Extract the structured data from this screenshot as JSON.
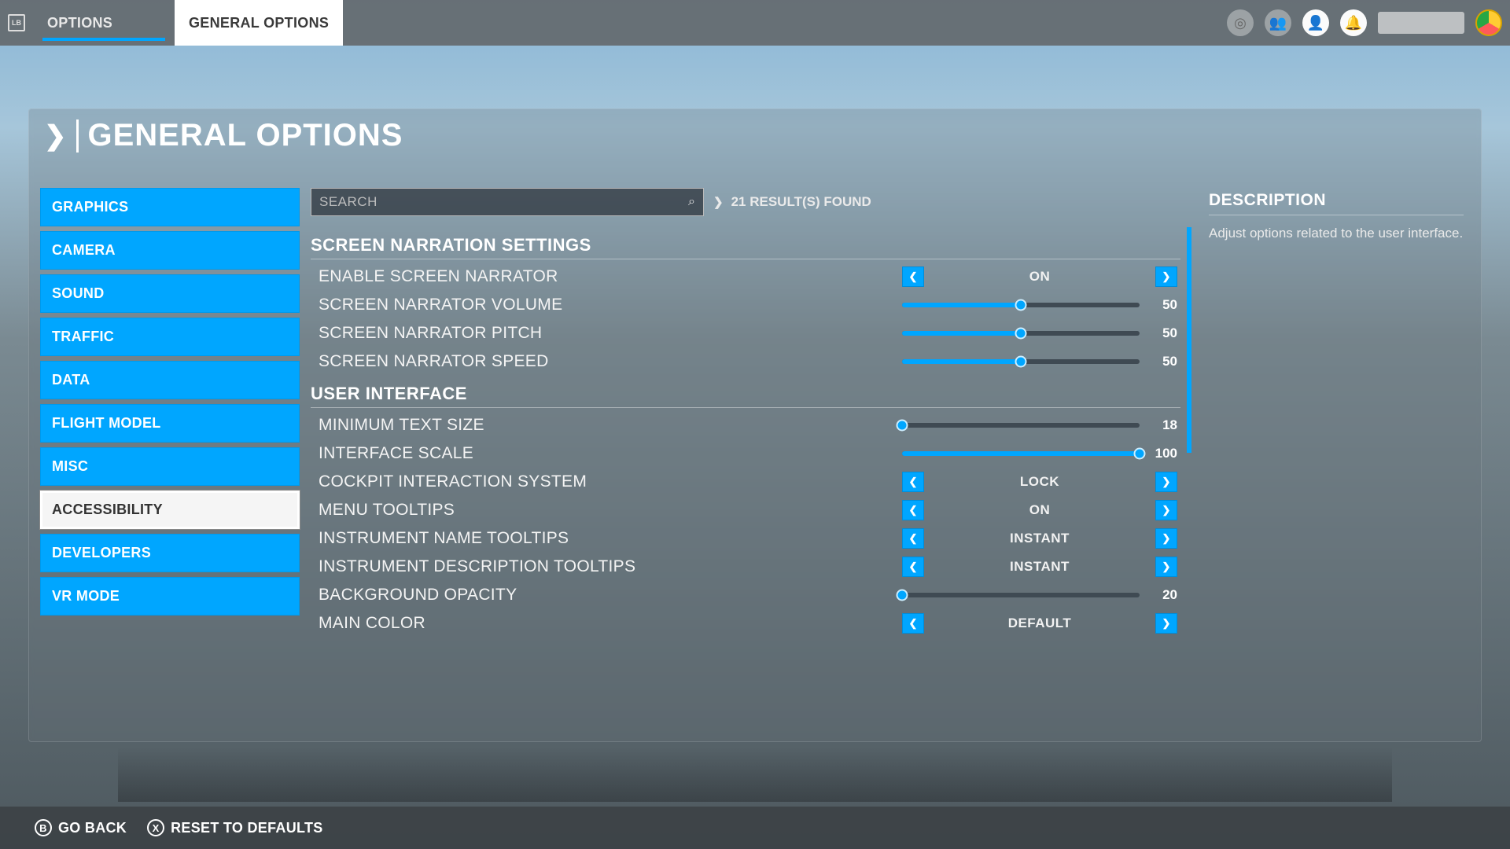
{
  "topbar": {
    "lb": "LB",
    "tabs": [
      {
        "label": "OPTIONS",
        "active": false,
        "accent": true
      },
      {
        "label": "GENERAL OPTIONS",
        "active": true,
        "accent": false
      }
    ]
  },
  "page": {
    "title": "GENERAL OPTIONS"
  },
  "sidebar": {
    "items": [
      {
        "label": "GRAPHICS",
        "selected": false
      },
      {
        "label": "CAMERA",
        "selected": false
      },
      {
        "label": "SOUND",
        "selected": false
      },
      {
        "label": "TRAFFIC",
        "selected": false
      },
      {
        "label": "DATA",
        "selected": false
      },
      {
        "label": "FLIGHT MODEL",
        "selected": false
      },
      {
        "label": "MISC",
        "selected": false
      },
      {
        "label": "ACCESSIBILITY",
        "selected": true
      },
      {
        "label": "DEVELOPERS",
        "selected": false
      },
      {
        "label": "VR MODE",
        "selected": false
      }
    ]
  },
  "search": {
    "placeholder": "SEARCH",
    "results_label": "21 RESULT(S) FOUND"
  },
  "groups": [
    {
      "title": "SCREEN NARRATION SETTINGS",
      "rows": [
        {
          "label": "ENABLE SCREEN NARRATOR",
          "type": "toggle",
          "value": "ON"
        },
        {
          "label": "SCREEN NARRATOR VOLUME",
          "type": "slider",
          "value": 50,
          "min": 0,
          "max": 100
        },
        {
          "label": "SCREEN NARRATOR PITCH",
          "type": "slider",
          "value": 50,
          "min": 0,
          "max": 100
        },
        {
          "label": "SCREEN NARRATOR SPEED",
          "type": "slider",
          "value": 50,
          "min": 0,
          "max": 100
        }
      ]
    },
    {
      "title": "USER INTERFACE",
      "rows": [
        {
          "label": "MINIMUM TEXT SIZE",
          "type": "slider",
          "value": 18,
          "min": 18,
          "max": 100
        },
        {
          "label": "INTERFACE SCALE",
          "type": "slider",
          "value": 100,
          "min": 0,
          "max": 100
        },
        {
          "label": "COCKPIT INTERACTION SYSTEM",
          "type": "toggle",
          "value": "LOCK"
        },
        {
          "label": "MENU TOOLTIPS",
          "type": "toggle",
          "value": "ON"
        },
        {
          "label": "INSTRUMENT NAME TOOLTIPS",
          "type": "toggle",
          "value": "INSTANT"
        },
        {
          "label": "INSTRUMENT DESCRIPTION TOOLTIPS",
          "type": "toggle",
          "value": "INSTANT"
        },
        {
          "label": "BACKGROUND OPACITY",
          "type": "slider",
          "value": 20,
          "min": 20,
          "max": 100
        },
        {
          "label": "MAIN COLOR",
          "type": "toggle",
          "value": "DEFAULT"
        }
      ]
    }
  ],
  "description": {
    "title": "DESCRIPTION",
    "body": "Adjust options related to the user interface."
  },
  "bottombar": {
    "goback_key": "B",
    "goback_label": "GO BACK",
    "reset_key": "X",
    "reset_label": "RESET TO DEFAULTS"
  },
  "colors": {
    "accent": "#00a6ff"
  }
}
